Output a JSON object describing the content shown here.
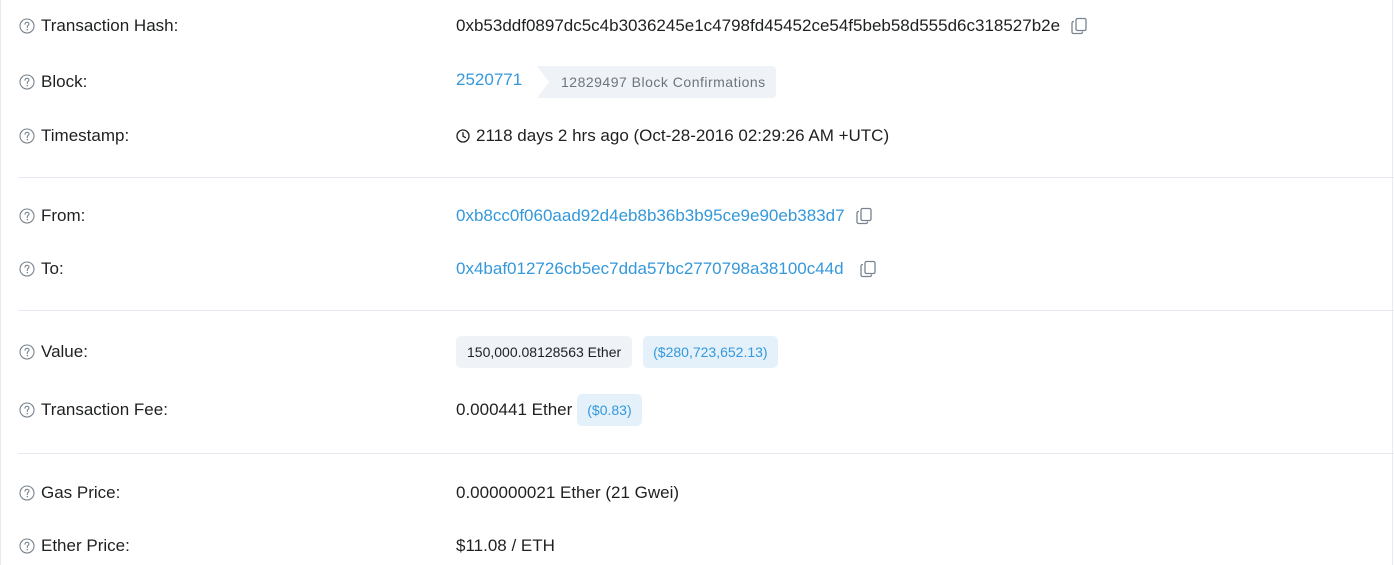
{
  "rows": {
    "tx_hash": {
      "label": "Transaction Hash:",
      "value": "0xb53ddf0897dc5c4b3036245e1c4798fd45452ce54f5beb58d555d6c318527b2e"
    },
    "block": {
      "label": "Block:",
      "number": "2520771",
      "confirmations": "12829497 Block Confirmations"
    },
    "timestamp": {
      "label": "Timestamp:",
      "value": "2118 days 2 hrs ago (Oct-28-2016 02:29:26 AM +UTC)"
    },
    "from": {
      "label": "From:",
      "address": "0xb8cc0f060aad92d4eb8b36b3b95ce9e90eb383d7"
    },
    "to": {
      "label": "To:",
      "address": "0x4baf012726cb5ec7dda57bc2770798a38100c44d"
    },
    "value": {
      "label": "Value:",
      "ether": "150,000.08128563 Ether",
      "usd": "($280,723,652.13)"
    },
    "fee": {
      "label": "Transaction Fee:",
      "ether": "0.000441 Ether",
      "usd": "($0.83)"
    },
    "gas_price": {
      "label": "Gas Price:",
      "value": "0.000000021 Ether (21 Gwei)"
    },
    "ether_price": {
      "label": "Ether Price:",
      "value": "$11.08 / ETH"
    }
  },
  "icons": {
    "help": "question-circle-icon",
    "copy": "copy-icon",
    "clock": "clock-icon"
  },
  "colors": {
    "link": "#3498db",
    "text": "#1e2022",
    "muted": "#6c757d",
    "badge_bg": "#eff2f7",
    "usd_bg": "#e4f1fb",
    "divider": "#e7eaf3"
  }
}
